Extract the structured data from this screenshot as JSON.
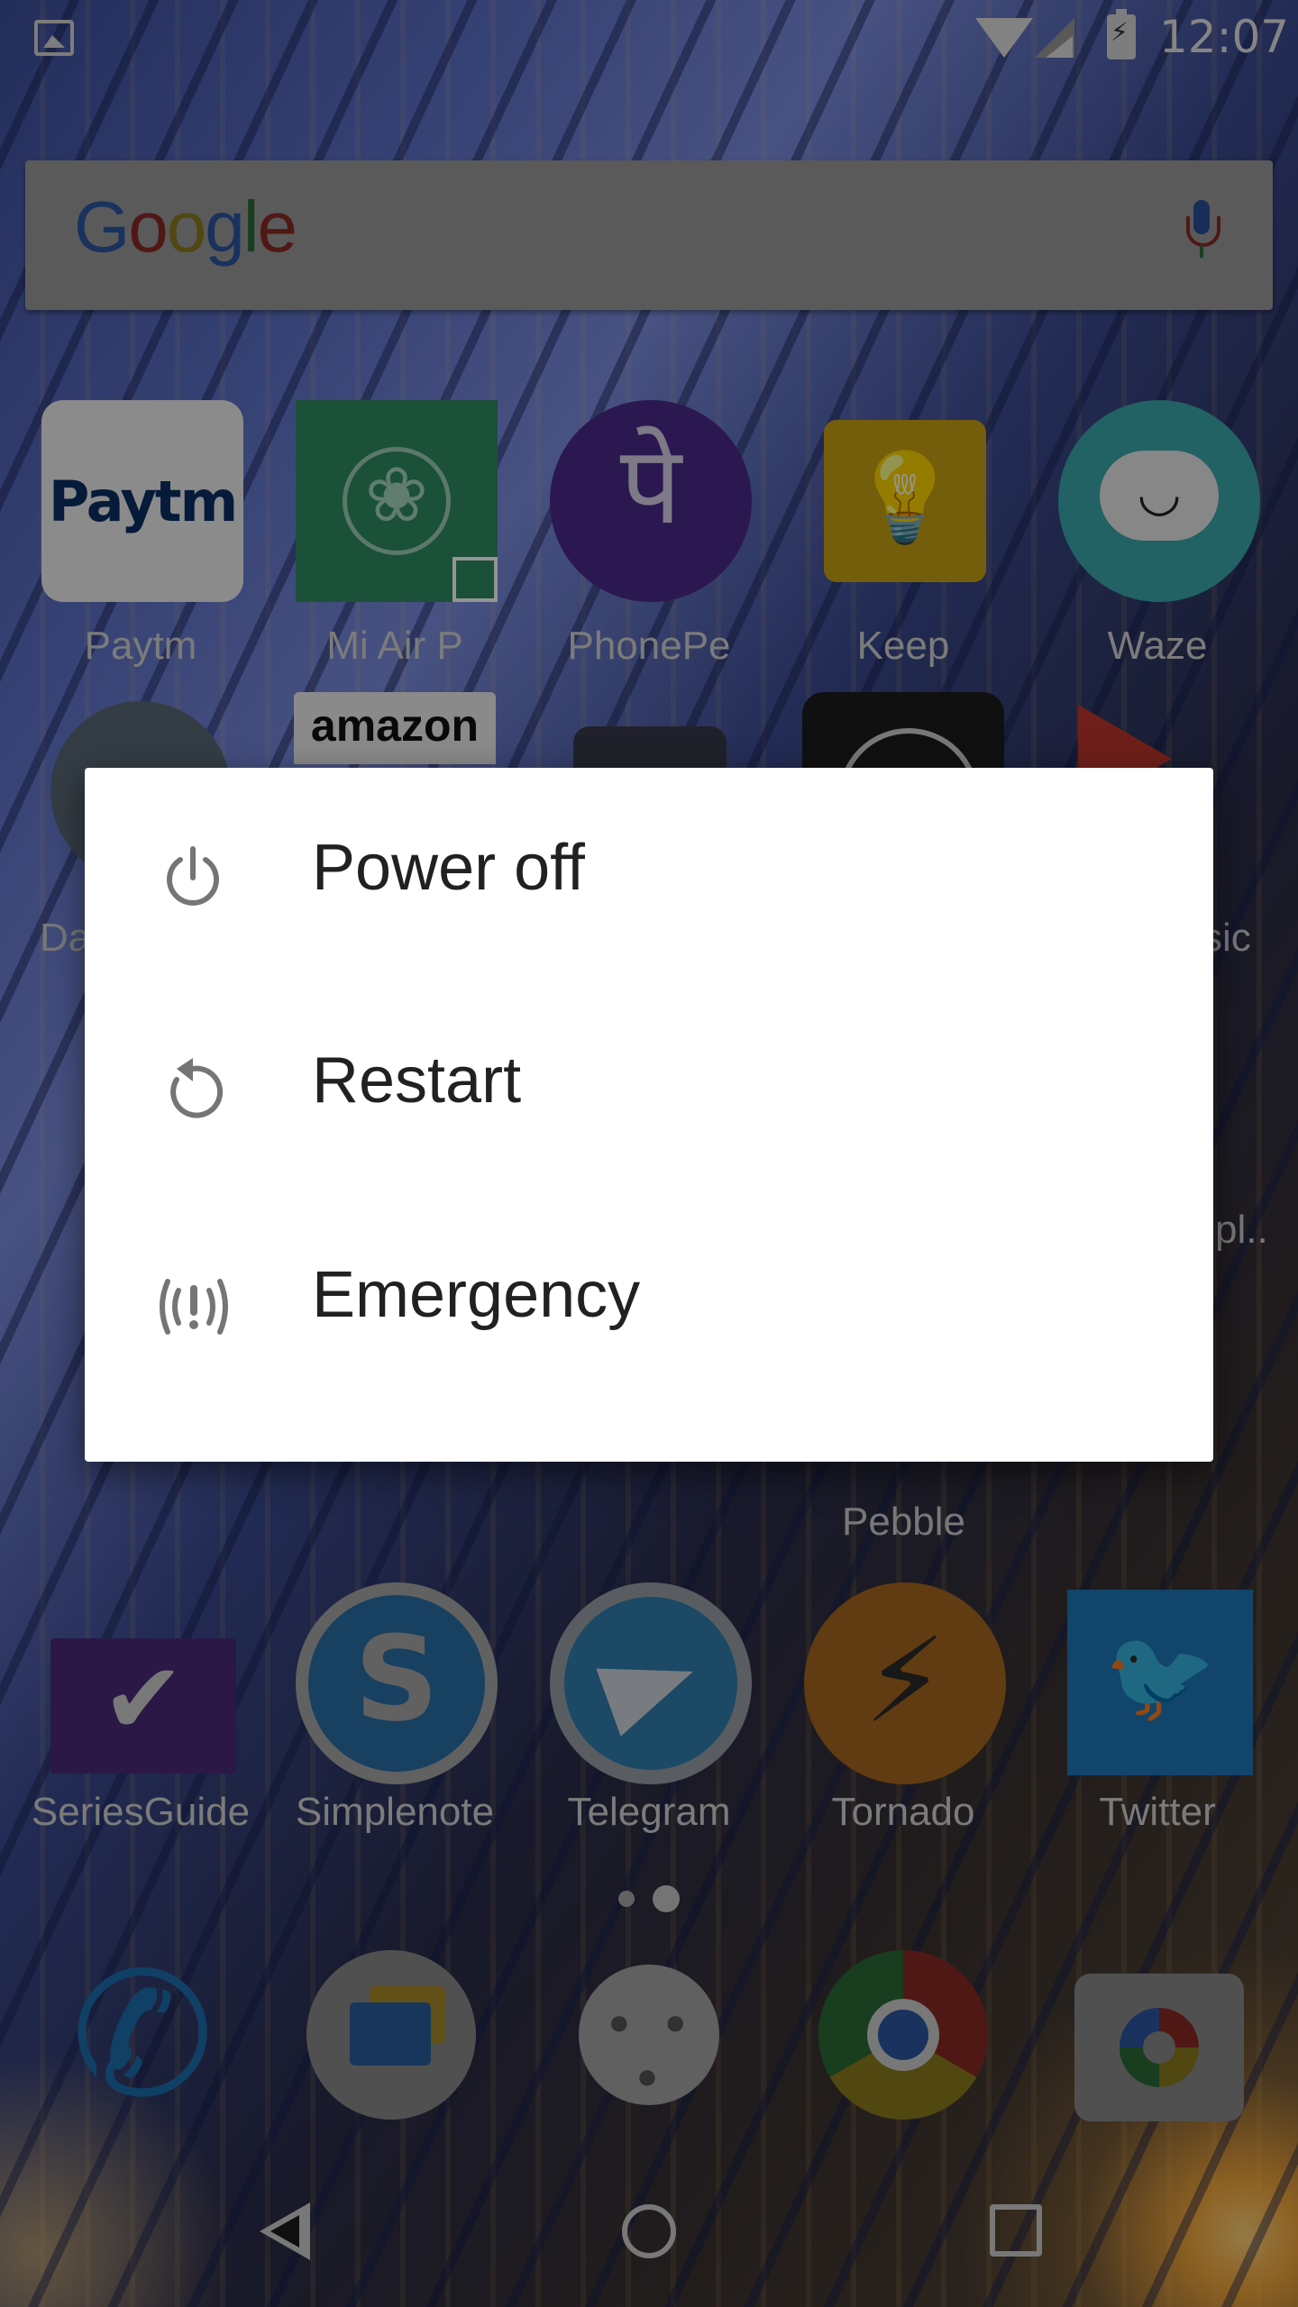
{
  "status_bar": {
    "time": "12:07",
    "icons": [
      "image-icon",
      "wifi-icon",
      "cell-signal-icon",
      "battery-charging-icon"
    ]
  },
  "search": {
    "logo_text": "Google",
    "logo_colors": [
      "#2c56a3",
      "#8a2a25",
      "#8a7a1e",
      "#2c56a3",
      "#2a6a36",
      "#8a2a25"
    ],
    "mic_icon": "mic-icon"
  },
  "home": {
    "row1": [
      {
        "label": "Paytm",
        "icon": "paytm-icon",
        "glyph": "Paytm"
      },
      {
        "label": "Mi Air P",
        "icon": "mi-air-purifier-icon"
      },
      {
        "label": "PhonePe",
        "icon": "phonepe-icon",
        "glyph": "पे"
      },
      {
        "label": "Keep",
        "icon": "lightbulb-icon",
        "glyph": "💡"
      },
      {
        "label": "Waze",
        "icon": "waze-icon",
        "glyph": "◡"
      }
    ],
    "peek_labels": {
      "left": "Da",
      "right_top": "sic",
      "right_mid": "pl..",
      "amazon": "amazon",
      "pebble": "Pebble"
    },
    "row3": [
      {
        "label": "SeriesGuide",
        "icon": "checkmark-icon",
        "glyph": "✔"
      },
      {
        "label": "Simplenote",
        "icon": "simplenote-icon",
        "glyph": "S"
      },
      {
        "label": "Telegram",
        "icon": "paper-plane-icon"
      },
      {
        "label": "Tornado",
        "icon": "tornado-icon",
        "glyph": "⚡"
      },
      {
        "label": "Twitter",
        "icon": "bird-icon",
        "glyph": "🐦"
      }
    ]
  },
  "dock": [
    {
      "name": "phone-icon",
      "glyph": "✆"
    },
    {
      "name": "messages-icon"
    },
    {
      "name": "app-drawer-icon",
      "glyph": "• • •"
    },
    {
      "name": "chrome-icon"
    },
    {
      "name": "camera-icon"
    }
  ],
  "power_menu": {
    "items": [
      {
        "label": "Power off",
        "icon": "power-icon"
      },
      {
        "label": "Restart",
        "icon": "restart-icon"
      },
      {
        "label": "Emergency",
        "icon": "emergency-broadcast-icon"
      }
    ]
  },
  "nav": {
    "back": "back-icon",
    "home": "home-icon",
    "recents": "recents-icon"
  }
}
